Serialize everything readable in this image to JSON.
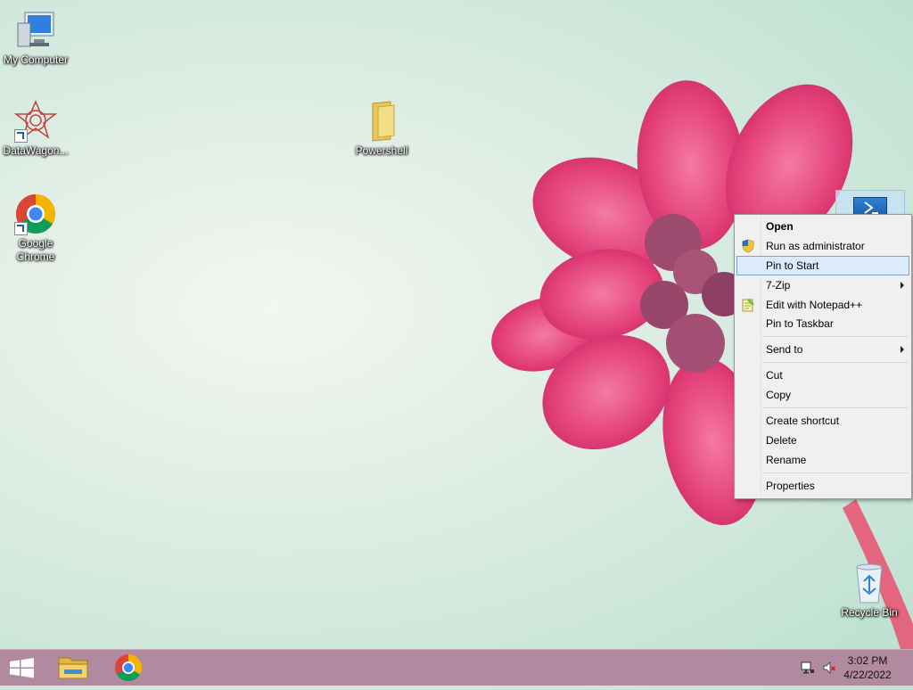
{
  "desktop": {
    "icons": [
      {
        "label": "My Computer"
      },
      {
        "label": "DataWagon..."
      },
      {
        "label": "Google Chrome"
      },
      {
        "label": "Powershell"
      },
      {
        "label": "Recycle Bin"
      }
    ]
  },
  "context_menu": {
    "items": [
      {
        "label": "Open",
        "bold": true
      },
      {
        "label": "Run as administrator",
        "icon": "uac-shield-icon"
      },
      {
        "label": "Pin to Start",
        "highlighted": true
      },
      {
        "label": "7-Zip",
        "submenu": true
      },
      {
        "label": "Edit with Notepad++",
        "icon": "notepad-plus-plus-icon"
      },
      {
        "label": "Pin to Taskbar"
      },
      {
        "label": "Send to",
        "submenu": true
      },
      {
        "label": "Cut"
      },
      {
        "label": "Copy"
      },
      {
        "label": "Create shortcut"
      },
      {
        "label": "Delete"
      },
      {
        "label": "Rename"
      },
      {
        "label": "Properties"
      }
    ]
  },
  "taskbar": {
    "buttons": [
      {
        "icon": "windows-start-icon"
      },
      {
        "icon": "file-explorer-icon"
      },
      {
        "icon": "chrome-icon"
      }
    ],
    "tray": {
      "network_icon": "network-icon",
      "volume_icon": "volume-muted-icon"
    },
    "clock": {
      "time": "3:02 PM",
      "date": "4/22/2022"
    }
  },
  "colors": {
    "taskbar": "#b28aa0",
    "menu_bg": "#f0f0f0",
    "highlight": "#dcebfc",
    "flower": "#e8467f"
  }
}
